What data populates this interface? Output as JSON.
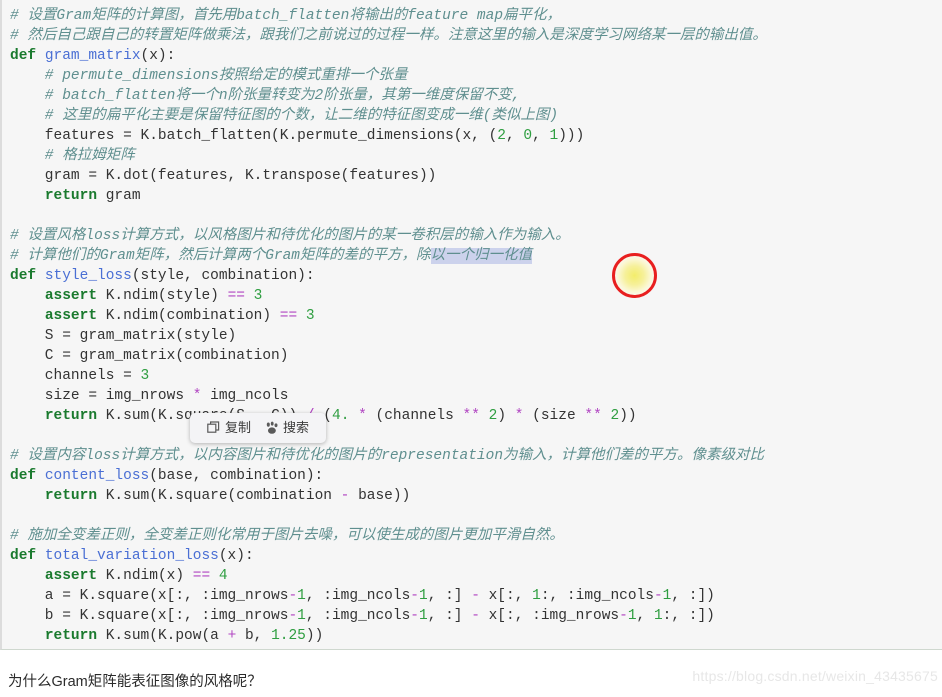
{
  "code_block": {
    "background": "#f6f6f6",
    "lines": [
      [
        {
          "t": "# 设置Gram矩阵的计算图，首先用batch_flatten将输出的feature map扁平化，",
          "c": "cm"
        }
      ],
      [
        {
          "t": "# 然后自己跟自己的转置矩阵做乘法，跟我们之前说过的过程一样。注意这里的输入是深度学习网络某一层的输出值。",
          "c": "cm"
        }
      ],
      [
        {
          "t": "def ",
          "c": "kw"
        },
        {
          "t": "gram_matrix",
          "c": "fn"
        },
        {
          "t": "(x):",
          "c": "pl"
        }
      ],
      [
        {
          "t": "    # permute_dimensions按照给定的模式重排一个张量",
          "c": "cm"
        }
      ],
      [
        {
          "t": "    # batch_flatten将一个n阶张量转变为2阶张量，其第一维度保留不变,",
          "c": "cm"
        }
      ],
      [
        {
          "t": "    # 这里的扁平化主要是保留特征图的个数，让二维的特征图变成一维(类似上图)",
          "c": "cm"
        }
      ],
      [
        {
          "t": "    features = K.batch_flatten(K.permute_dimensions(x, (",
          "c": "pl"
        },
        {
          "t": "2",
          "c": "num"
        },
        {
          "t": ", ",
          "c": "pl"
        },
        {
          "t": "0",
          "c": "num"
        },
        {
          "t": ", ",
          "c": "pl"
        },
        {
          "t": "1",
          "c": "num"
        },
        {
          "t": ")))",
          "c": "pl"
        }
      ],
      [
        {
          "t": "    # 格拉姆矩阵",
          "c": "cm"
        }
      ],
      [
        {
          "t": "    gram = K.dot(features, K.transpose(features))",
          "c": "pl"
        }
      ],
      [
        {
          "t": "    ",
          "c": "pl"
        },
        {
          "t": "return",
          "c": "kw"
        },
        {
          "t": " gram",
          "c": "pl"
        }
      ],
      [],
      [
        {
          "t": "# 设置风格loss计算方式，以风格图片和待优化的图片的某一卷积层的输入作为输入。",
          "c": "cm"
        }
      ],
      [
        {
          "t": "# 计算他们的Gram矩阵，然后计算两个Gram矩阵的差的平方，除",
          "c": "cm"
        },
        {
          "t": "以一个归一化值",
          "c": "cm sel"
        }
      ],
      [
        {
          "t": "def ",
          "c": "kw"
        },
        {
          "t": "style_loss",
          "c": "fn"
        },
        {
          "t": "(style, combination):",
          "c": "pl"
        }
      ],
      [
        {
          "t": "    ",
          "c": "pl"
        },
        {
          "t": "assert",
          "c": "kw"
        },
        {
          "t": " K.ndim(style) ",
          "c": "pl"
        },
        {
          "t": "==",
          "c": "op"
        },
        {
          "t": " ",
          "c": "pl"
        },
        {
          "t": "3",
          "c": "num"
        }
      ],
      [
        {
          "t": "    ",
          "c": "pl"
        },
        {
          "t": "assert",
          "c": "kw"
        },
        {
          "t": " K.ndim(combination) ",
          "c": "pl"
        },
        {
          "t": "==",
          "c": "op"
        },
        {
          "t": " ",
          "c": "pl"
        },
        {
          "t": "3",
          "c": "num"
        }
      ],
      [
        {
          "t": "    S = gram_matrix(style)",
          "c": "pl"
        }
      ],
      [
        {
          "t": "    C = gram_matrix(combination)",
          "c": "pl"
        }
      ],
      [
        {
          "t": "    channels = ",
          "c": "pl"
        },
        {
          "t": "3",
          "c": "num"
        }
      ],
      [
        {
          "t": "    size = img_nrows ",
          "c": "pl"
        },
        {
          "t": "*",
          "c": "op"
        },
        {
          "t": " img_ncols",
          "c": "pl"
        }
      ],
      [
        {
          "t": "    ",
          "c": "pl"
        },
        {
          "t": "return",
          "c": "kw"
        },
        {
          "t": " K.sum(K.square(S ",
          "c": "pl"
        },
        {
          "t": "-",
          "c": "op"
        },
        {
          "t": " C)) ",
          "c": "pl"
        },
        {
          "t": "/",
          "c": "op"
        },
        {
          "t": " (",
          "c": "pl"
        },
        {
          "t": "4.",
          "c": "num"
        },
        {
          "t": " ",
          "c": "pl"
        },
        {
          "t": "*",
          "c": "op"
        },
        {
          "t": " (channels ",
          "c": "pl"
        },
        {
          "t": "**",
          "c": "op"
        },
        {
          "t": " ",
          "c": "pl"
        },
        {
          "t": "2",
          "c": "num"
        },
        {
          "t": ") ",
          "c": "pl"
        },
        {
          "t": "*",
          "c": "op"
        },
        {
          "t": " (size ",
          "c": "pl"
        },
        {
          "t": "**",
          "c": "op"
        },
        {
          "t": " ",
          "c": "pl"
        },
        {
          "t": "2",
          "c": "num"
        },
        {
          "t": "))",
          "c": "pl"
        }
      ],
      [],
      [
        {
          "t": "# 设置内容loss计算方式，以内容图片和待优化的图片的representation为输入，计算他们差的平方。像素级对比",
          "c": "cm"
        }
      ],
      [
        {
          "t": "def ",
          "c": "kw"
        },
        {
          "t": "content_loss",
          "c": "fn"
        },
        {
          "t": "(base, combination):",
          "c": "pl"
        }
      ],
      [
        {
          "t": "    ",
          "c": "pl"
        },
        {
          "t": "return",
          "c": "kw"
        },
        {
          "t": " K.sum(K.square(combination ",
          "c": "pl"
        },
        {
          "t": "-",
          "c": "op"
        },
        {
          "t": " base))",
          "c": "pl"
        }
      ],
      [],
      [
        {
          "t": "# 施加全变差正则，全变差正则化常用于图片去噪，可以使生成的图片更加平滑自然。",
          "c": "cm"
        }
      ],
      [
        {
          "t": "def ",
          "c": "kw"
        },
        {
          "t": "total_variation_loss",
          "c": "fn"
        },
        {
          "t": "(x):",
          "c": "pl"
        }
      ],
      [
        {
          "t": "    ",
          "c": "pl"
        },
        {
          "t": "assert",
          "c": "kw"
        },
        {
          "t": " K.ndim(x) ",
          "c": "pl"
        },
        {
          "t": "==",
          "c": "op"
        },
        {
          "t": " ",
          "c": "pl"
        },
        {
          "t": "4",
          "c": "num"
        }
      ],
      [
        {
          "t": "    a = K.square(x[:, :img_nrows",
          "c": "pl"
        },
        {
          "t": "-",
          "c": "op"
        },
        {
          "t": "1",
          "c": "num"
        },
        {
          "t": ", :img_ncols",
          "c": "pl"
        },
        {
          "t": "-",
          "c": "op"
        },
        {
          "t": "1",
          "c": "num"
        },
        {
          "t": ", :] ",
          "c": "pl"
        },
        {
          "t": "-",
          "c": "op"
        },
        {
          "t": " x[:, ",
          "c": "pl"
        },
        {
          "t": "1",
          "c": "num"
        },
        {
          "t": ":, :img_ncols",
          "c": "pl"
        },
        {
          "t": "-",
          "c": "op"
        },
        {
          "t": "1",
          "c": "num"
        },
        {
          "t": ", :])",
          "c": "pl"
        }
      ],
      [
        {
          "t": "    b = K.square(x[:, :img_nrows",
          "c": "pl"
        },
        {
          "t": "-",
          "c": "op"
        },
        {
          "t": "1",
          "c": "num"
        },
        {
          "t": ", :img_ncols",
          "c": "pl"
        },
        {
          "t": "-",
          "c": "op"
        },
        {
          "t": "1",
          "c": "num"
        },
        {
          "t": ", :] ",
          "c": "pl"
        },
        {
          "t": "-",
          "c": "op"
        },
        {
          "t": " x[:, :img_nrows",
          "c": "pl"
        },
        {
          "t": "-",
          "c": "op"
        },
        {
          "t": "1",
          "c": "num"
        },
        {
          "t": ", ",
          "c": "pl"
        },
        {
          "t": "1",
          "c": "num"
        },
        {
          "t": ":, :])",
          "c": "pl"
        }
      ],
      [
        {
          "t": "    ",
          "c": "pl"
        },
        {
          "t": "return",
          "c": "kw"
        },
        {
          "t": " K.sum(K.pow(a ",
          "c": "pl"
        },
        {
          "t": "+",
          "c": "op"
        },
        {
          "t": " b, ",
          "c": "pl"
        },
        {
          "t": "1.25",
          "c": "num"
        },
        {
          "t": "))",
          "c": "pl"
        }
      ]
    ]
  },
  "selection": {
    "selected_text": "以一个归一化值",
    "highlight_color": "#ccd2ec"
  },
  "context_popup": {
    "items": [
      {
        "label": "复制",
        "icon": "copy-icon"
      },
      {
        "label": "搜索",
        "icon": "search-paw-icon"
      }
    ]
  },
  "click_marker": {
    "ring_color": "#e81f1f",
    "glow_color": "#f3ed6a"
  },
  "footer": {
    "question": "为什么Gram矩阵能表征图像的风格呢？"
  },
  "watermark": {
    "text": "https://blog.csdn.net/weixin_43435675",
    "color": "#e7e7e7"
  }
}
